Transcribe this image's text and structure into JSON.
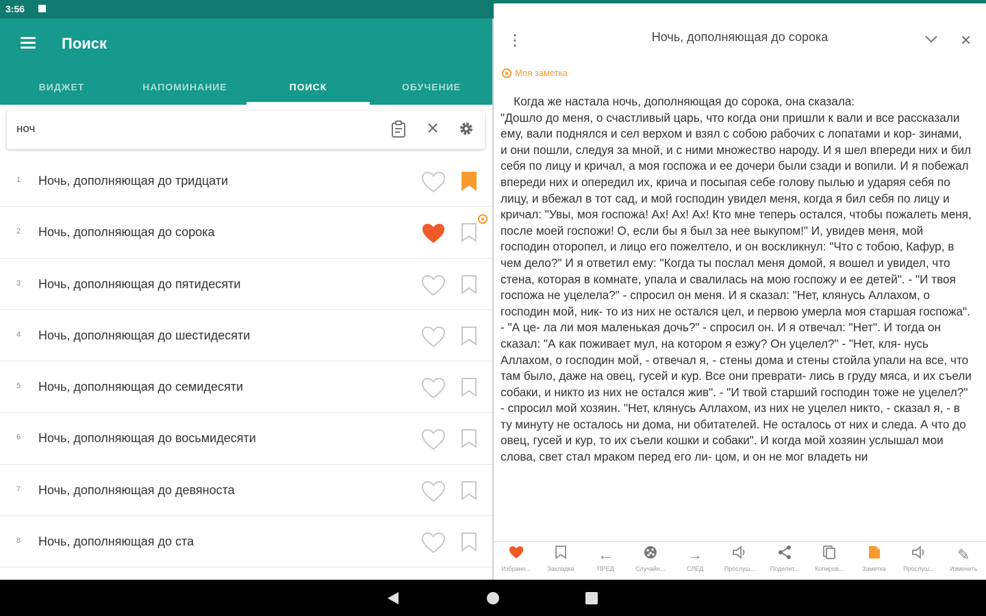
{
  "status_bar": {
    "time": "3:56"
  },
  "app": {
    "title": "Поиск",
    "tabs": [
      {
        "label": "ВИДЖЕТ",
        "active": false
      },
      {
        "label": "НАПОМИНАНИЕ",
        "active": false
      },
      {
        "label": "ПОИСК",
        "active": true
      },
      {
        "label": "ОБУЧЕНИЕ",
        "active": false
      }
    ],
    "colors": {
      "primary": "#159a8b",
      "status": "#0f7a6d",
      "accent": "#f89a2d",
      "favorite": "#f05a28"
    }
  },
  "search": {
    "value": "ноч",
    "icons": [
      "clipboard-icon",
      "clear-icon",
      "settings-gear-icon"
    ]
  },
  "results": [
    {
      "num": "1",
      "title": "Ночь, дополняющая до тридцати",
      "favorite": false,
      "bookmarked": true,
      "has_note": false
    },
    {
      "num": "2",
      "title": "Ночь, дополняющая до сорока",
      "favorite": true,
      "bookmarked": false,
      "has_note": true
    },
    {
      "num": "3",
      "title": "Ночь, дополняющая до пятидесяти",
      "favorite": false,
      "bookmarked": false,
      "has_note": false
    },
    {
      "num": "4",
      "title": "Ночь, дополняющая до шестидесяти",
      "favorite": false,
      "bookmarked": false,
      "has_note": false
    },
    {
      "num": "5",
      "title": "Ночь, дополняющая до семидесяти",
      "favorite": false,
      "bookmarked": false,
      "has_note": false
    },
    {
      "num": "6",
      "title": "Ночь, дополняющая до восьмидесяти",
      "favorite": false,
      "bookmarked": false,
      "has_note": false
    },
    {
      "num": "7",
      "title": "Ночь, дополняющая до девяноста",
      "favorite": false,
      "bookmarked": false,
      "has_note": false
    },
    {
      "num": "8",
      "title": "Ночь, дополняющая до ста",
      "favorite": false,
      "bookmarked": false,
      "has_note": false
    }
  ],
  "reader": {
    "title": "Ночь, дополняющая до сорока",
    "note_label": "Моя заметка",
    "text": "    Когда же настала ночь, дополняющая до сорока, она сказала:\n\"Дошло до меня, о счастливый царь, что когда они пришли к вали и все рассказали ему, вали поднялся и сел верхом и взял с собою рабочих с лопатами и кор- зинами, и они пошли, следуя за мной, и с ними множество народу. И я шел впереди них и бил себя по лицу и кричал, а моя госпожа и ее дочери были сзади и вопили. И я побежал впереди них и опередил их, крича и посыпая себе голову пылью и ударяя себя по лицу, и вбежал в тот сад, и мой господин увидел меня, когда я бил себя по лицу и кричал: \"Увы, моя госпожа! Ах! Ах! Ах! Кто мне теперь остался, чтобы пожалеть меня, после моей госпожи! О, если бы я был за нее выкупом!\" И, увидев меня, мой господин оторопел, и лицо его пожелтело, и он воскликнул: \"Что с тобою, Кафур, в чем дело?\" И я ответил ему: \"Когда ты послал меня домой, я вошел и увидел, что стена, которая в комнате, упала и свалилась на мою госпожу и ее детей\". - \"И твоя госпожа не уцелела?\" - спросил он меня. И я сказал: \"Нет, клянусь Аллахом, о господин мой, ник- то из них не остался цел, и первою умерла моя старшая госпожа\". - \"А це- ла ли моя маленькая дочь?\" - спросил он. И я отвечал: \"Нет\". И тогда он сказал: \"А как поживает мул, на котором я езжу? Он уцелел?\" - \"Нет, кля- нусь Аллахом, о господин мой, - отвечал я, - стены дома и стены стойла упали на все, что там было, даже на овец, гусей и кур. Все они преврати- лись в груду мяса, и их съели собаки, и никто из них не остался жив\". - \"И твой старший господин тоже не уцелел?\" - спросил мой хозяин. \"Нет, клянусь Аллахом, из них не уцелел никто, - сказал я, - в ту минуту не осталось ни дома, ни обитателей. Не осталось от них и следа. А что до овец, гусей и кур, то их съели кошки и собаки\". И когда мой хозяин услышал мои слова, свет стал мраком перед его ли- цом, и он не мог владеть ни",
    "toolbar": [
      {
        "icon": "heart-filled-icon",
        "label": "Избранн...",
        "active": true
      },
      {
        "icon": "bookmark-icon",
        "label": "Закладка",
        "active": false
      },
      {
        "icon": "arrow-left-icon",
        "label": "ПРЕД",
        "active": false
      },
      {
        "icon": "random-icon",
        "label": "Случайн...",
        "active": false
      },
      {
        "icon": "arrow-right-icon",
        "label": "СЛЕД",
        "active": false
      },
      {
        "icon": "speaker-icon",
        "label": "Прослуш...",
        "active": false
      },
      {
        "icon": "share-icon",
        "label": "Поделит...",
        "active": false
      },
      {
        "icon": "copy-icon",
        "label": "Копиров...",
        "active": false
      },
      {
        "icon": "note-icon",
        "label": "Заметка",
        "active": true
      },
      {
        "icon": "speaker-icon",
        "label": "Прослуш...",
        "active": false
      },
      {
        "icon": "edit-pencil-icon",
        "label": "Изменить",
        "active": false
      }
    ]
  }
}
